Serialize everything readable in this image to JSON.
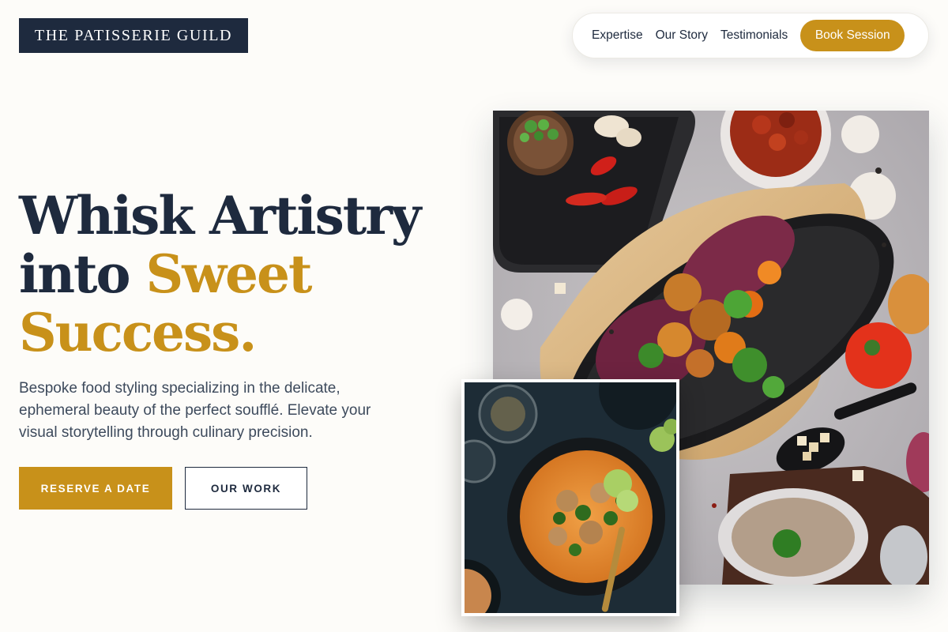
{
  "brand": {
    "name": "THE PATISSERIE GUILD"
  },
  "nav": {
    "links": [
      "Expertise",
      "Our Story",
      "Testimonials"
    ],
    "cta": "Book Session"
  },
  "hero": {
    "headline_line1": "Whisk Artistry",
    "headline_line2_plain": "into ",
    "headline_line2_accent": "Sweet",
    "headline_line3_accent": "Success.",
    "description": "Bespoke food styling specializing in the delicate, ephemeral beauty of the perfect soufflé. Elevate your visual storytelling through culinary precision.",
    "primary_button": "RESERVE A DATE",
    "secondary_button": "OUR WORK"
  },
  "images": {
    "main": "food-photo-sizzling-platter-icon",
    "inset": "food-photo-curry-bowl-icon"
  },
  "colors": {
    "navy": "#1e2a3e",
    "gold": "#c8911a",
    "background": "#fdfcf9"
  }
}
